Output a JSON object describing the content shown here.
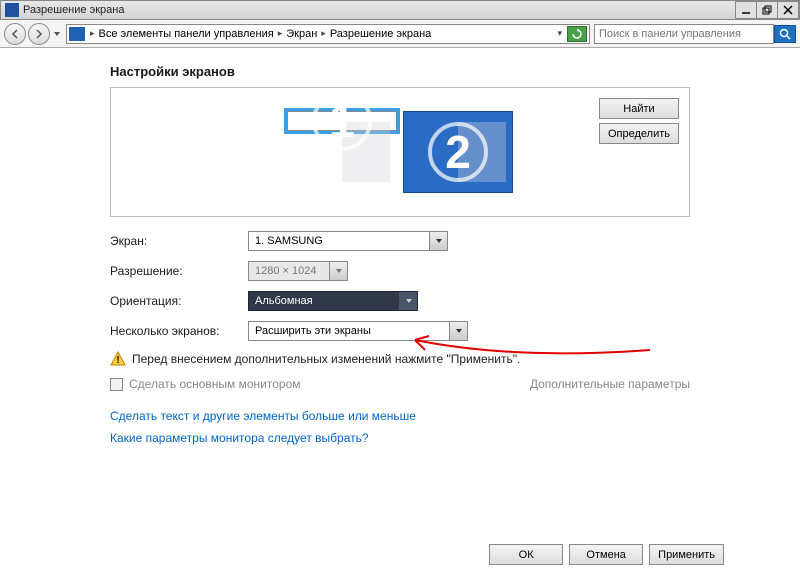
{
  "window": {
    "title": "Разрешение экрана"
  },
  "breadcrumb": {
    "seg1": "Все элементы панели управления",
    "seg2": "Экран",
    "seg3": "Разрешение экрана"
  },
  "search": {
    "placeholder": "Поиск в панели управления"
  },
  "heading": "Настройки экранов",
  "monitors": {
    "n1": "1",
    "n2": "2"
  },
  "zonebuttons": {
    "find": "Найти",
    "identify": "Определить"
  },
  "labels": {
    "screen": "Экран:",
    "resolution": "Разрешение:",
    "orientation": "Ориентация:",
    "multiple": "Несколько экранов:"
  },
  "values": {
    "screen": "1. SAMSUNG",
    "resolution": "1280 × 1024",
    "orientation": "Альбомная",
    "multiple": "Расширить эти экраны"
  },
  "warning": "Перед внесением дополнительных изменений нажмите \"Применить\".",
  "checkbox": "Сделать основным монитором",
  "advanced": "Дополнительные параметры",
  "links": {
    "textsize": "Сделать текст и другие элементы больше или меньше",
    "which": "Какие параметры монитора следует выбрать?"
  },
  "buttons": {
    "ok": "ОК",
    "cancel": "Отмена",
    "apply": "Применить"
  }
}
